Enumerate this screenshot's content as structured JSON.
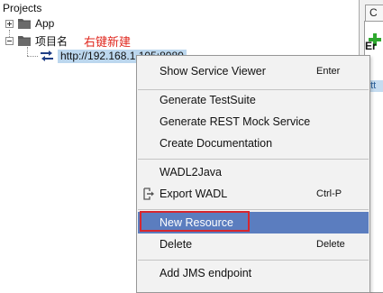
{
  "tree": {
    "panel_title": "Projects",
    "items": [
      {
        "label": "App",
        "expander": "plus"
      },
      {
        "label": "项目名",
        "expander": "minus",
        "annotation": "右键新建"
      },
      {
        "label": "http://192.168.1.105:8080"
      }
    ]
  },
  "right_panel": {
    "tab_label": "C",
    "header": "Er",
    "link_text": "htt"
  },
  "context_menu": {
    "groups": [
      [
        {
          "label": "Show Service Viewer",
          "shortcut": "Enter"
        }
      ],
      [
        {
          "label": "Generate TestSuite",
          "shortcut": ""
        },
        {
          "label": "Generate REST Mock Service",
          "shortcut": ""
        },
        {
          "label": "Create Documentation",
          "shortcut": ""
        }
      ],
      [
        {
          "label": "WADL2Java",
          "shortcut": ""
        },
        {
          "label": "Export WADL",
          "shortcut": "Ctrl-P",
          "icon": "export-icon"
        }
      ],
      [
        {
          "label": "New Resource",
          "shortcut": "",
          "selected": true
        },
        {
          "label": "Delete",
          "shortcut": "Delete"
        }
      ],
      [
        {
          "label": "Add JMS endpoint",
          "shortcut": ""
        }
      ]
    ]
  },
  "colors": {
    "menu_selected_bg": "#5b7dbf",
    "annotation": "#e0281f",
    "highlight_box": "#d7262e",
    "endpoint_selection": "#bcd7ee"
  }
}
